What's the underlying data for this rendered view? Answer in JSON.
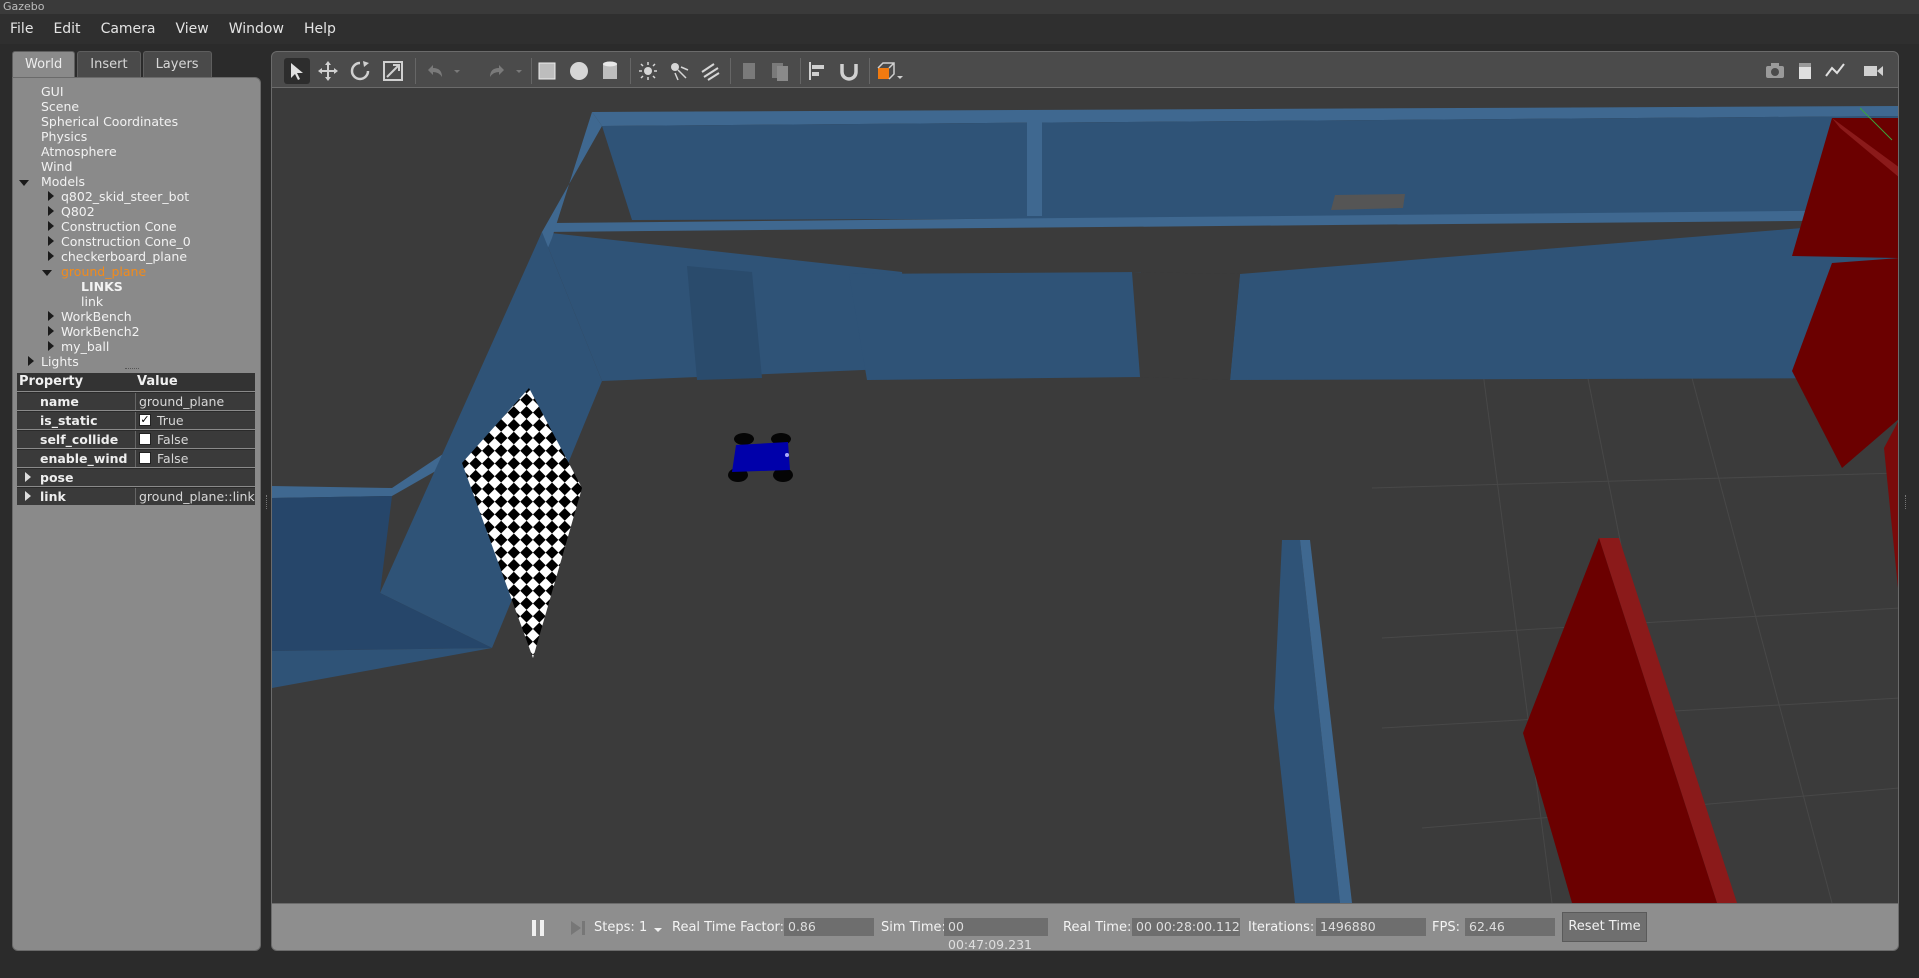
{
  "window": {
    "title": "Gazebo"
  },
  "menu": [
    "File",
    "Edit",
    "Camera",
    "View",
    "Window",
    "Help"
  ],
  "tabs": [
    "World",
    "Insert",
    "Layers"
  ],
  "world_tree": {
    "items": [
      "GUI",
      "Scene",
      "Spherical Coordinates",
      "Physics",
      "Atmosphere",
      "Wind"
    ],
    "models_label": "Models",
    "models": [
      "q802_skid_steer_bot",
      "Q802",
      "Construction Cone",
      "Construction Cone_0",
      "checkerboard_plane"
    ],
    "selected_model": "ground_plane",
    "links_header": "LINKS",
    "link_name": "link",
    "models_after": [
      "WorkBench",
      "WorkBench2",
      "my_ball"
    ],
    "lights_label": "Lights"
  },
  "properties": {
    "header_property": "Property",
    "header_value": "Value",
    "name_key": "name",
    "name_value": "ground_plane",
    "is_static_key": "is_static",
    "is_static_value": "True",
    "self_collide_key": "self_collide",
    "self_collide_value": "False",
    "enable_wind_key": "enable_wind",
    "enable_wind_value": "False",
    "pose_key": "pose",
    "link_key": "link",
    "link_value": "ground_plane::link"
  },
  "toolbar_icons": [
    "select-arrow-icon",
    "translate-icon",
    "rotate-icon",
    "scale-icon",
    "undo-icon",
    "redo-icon",
    "box-icon",
    "sphere-icon",
    "cylinder-icon",
    "point-light-icon",
    "spot-light-icon",
    "directional-light-icon",
    "copy-icon",
    "paste-icon",
    "align-icon",
    "snap-icon",
    "view-angle-icon",
    "screenshot-icon",
    "log-icon",
    "plot-icon",
    "video-record-icon"
  ],
  "bottom": {
    "steps_label": "Steps:",
    "steps_value": "1",
    "rtf_label": "Real Time Factor:",
    "rtf_value": "0.86",
    "sim_time_label": "Sim Time:",
    "sim_time_value": "00 00:47:09.231",
    "real_time_label": "Real Time:",
    "real_time_value": "00 00:28:00.112",
    "iterations_label": "Iterations:",
    "iterations_value": "1496880",
    "fps_label": "FPS:",
    "fps_value": "62.46",
    "reset_label": "Reset Time"
  },
  "colors": {
    "wall_blue": "#2f5377",
    "wall_red": "#6b0000",
    "ground": "#3b3b3b",
    "selected_text": "#f28a1a"
  }
}
